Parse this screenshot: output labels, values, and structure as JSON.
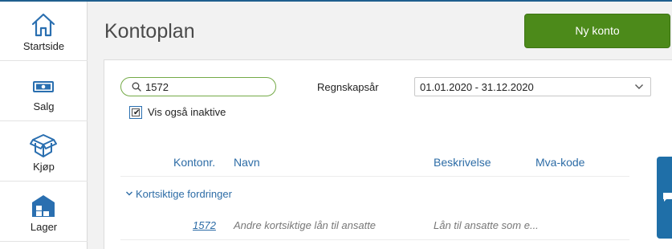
{
  "sidebar": {
    "items": [
      {
        "label": "Startside",
        "icon": "home-icon"
      },
      {
        "label": "Salg",
        "icon": "money-icon"
      },
      {
        "label": "Kjøp",
        "icon": "box-icon"
      },
      {
        "label": "Lager",
        "icon": "warehouse-icon"
      }
    ]
  },
  "header": {
    "title": "Kontoplan",
    "new_button_label": "Ny konto"
  },
  "filters": {
    "search_value": "1572",
    "year_label": "Regnskapsår",
    "year_value": "01.01.2020 - 31.12.2020",
    "show_inactive_label": "Vis også inaktive",
    "show_inactive_checked": true
  },
  "table": {
    "columns": [
      "Kontonr.",
      "Navn",
      "Beskrivelse",
      "Mva-kode"
    ],
    "group_label": "Kortsiktige fordringer",
    "rows": [
      {
        "account": "1572",
        "name": "Andre kortsiktige lån til ansatte",
        "description": "Lån til ansatte som e...",
        "vat": ""
      }
    ]
  },
  "colors": {
    "accent_green": "#4c8a1a",
    "link_blue": "#2d6ca6",
    "chat_blue": "#1f6fa8"
  }
}
